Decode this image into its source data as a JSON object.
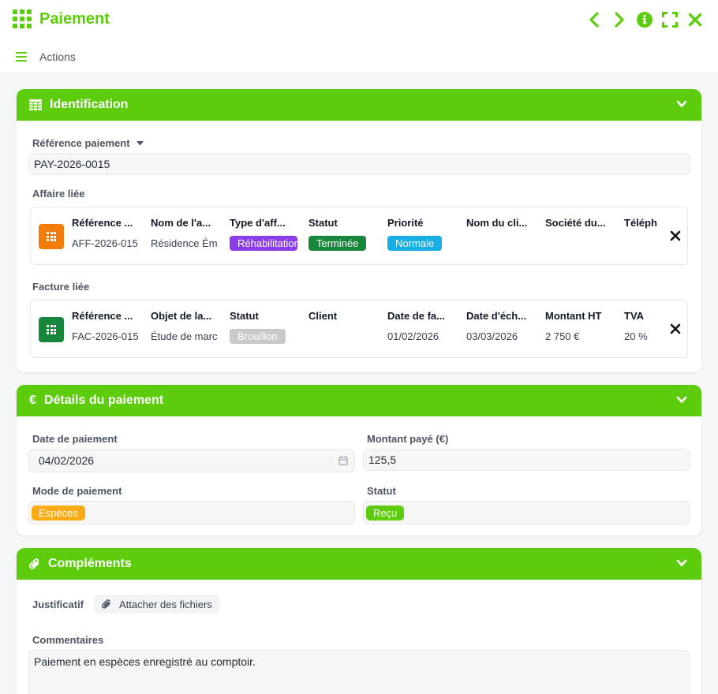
{
  "app": {
    "title": "Paiement",
    "actions_label": "Actions"
  },
  "colors": {
    "accent": "#5ccc0c",
    "orange": "#f47c0b",
    "green_dark": "#16873b"
  },
  "identification": {
    "title": "Identification",
    "ref_label": "Référence paiement",
    "ref_value": "PAY-2026-0015",
    "affaire_label": "Affaire liée",
    "affaire": {
      "headers": [
        "Référence ...",
        "Nom de l'a...",
        "Type d'aff...",
        "Statut",
        "Priorité",
        "Nom du cli...",
        "Société du...",
        "Téléph"
      ],
      "values": {
        "ref": "AFF-2026-015",
        "nom": "Résidence Ém",
        "type": "Réhabilitation",
        "statut": "Terminée",
        "priorite": "Normale"
      }
    },
    "facture_label": "Facture liée",
    "facture": {
      "headers": [
        "Référence ...",
        "Objet de la...",
        "Statut",
        "Client",
        "Date de fa...",
        "Date d'éch...",
        "Montant HT",
        "TVA"
      ],
      "values": {
        "ref": "FAC-2026-015",
        "objet": "Étude de marc",
        "statut": "Brouillon",
        "client": "",
        "date_fac": "01/02/2026",
        "date_ech": "03/03/2026",
        "montant": "2 750 €",
        "tva": "20 %"
      }
    }
  },
  "details": {
    "title": "Détails du paiement",
    "currency_symbol": "€",
    "date_label": "Date de paiement",
    "date_value": "04/02/2026",
    "montant_label": "Montant payé (€)",
    "montant_value": "125,5",
    "mode_label": "Mode de paiement",
    "mode_value": "Espèces",
    "statut_label": "Statut",
    "statut_value": "Reçu"
  },
  "complements": {
    "title": "Compléments",
    "justificatif_label": "Justificatif",
    "attach_label": "Attacher des fichiers",
    "commentaires_label": "Commentaires",
    "commentaires_value": "Paiement en espèces enregistré au comptoir."
  }
}
